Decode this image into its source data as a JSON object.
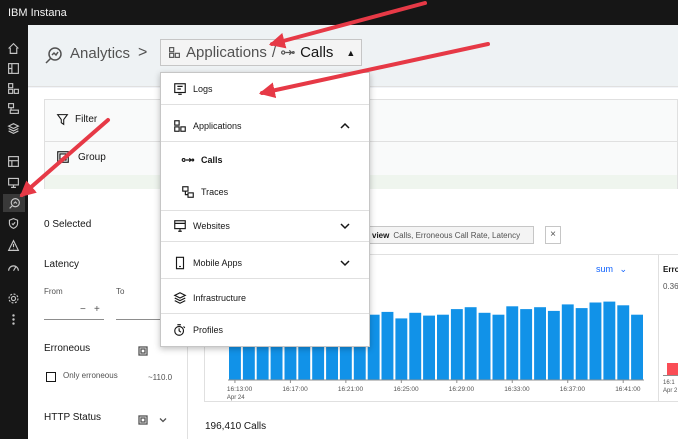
{
  "app": {
    "title": "IBM Instana"
  },
  "sidebar": {
    "items": [
      {
        "name": "home-icon"
      },
      {
        "name": "websites-icon"
      },
      {
        "name": "applications-icon"
      },
      {
        "name": "services-icon"
      },
      {
        "name": "infrastructure-icon"
      },
      {
        "name": "platforms-icon"
      },
      {
        "name": "monitor-icon"
      },
      {
        "name": "analytics-icon",
        "active": true
      },
      {
        "name": "security-icon"
      },
      {
        "name": "events-icon"
      },
      {
        "name": "dashboard-icon"
      },
      {
        "name": "settings-icon"
      },
      {
        "name": "more-icon"
      }
    ]
  },
  "breadcrumb": {
    "root": "Analytics",
    "separator": ">",
    "section": "Applications",
    "divider": "/",
    "current": "Calls"
  },
  "filter": {
    "filter_label": "Filter",
    "group_label": "Group"
  },
  "left_panel": {
    "selected": "0 Selected",
    "latency_label": "Latency",
    "from_label": "From",
    "to_label": "To",
    "minus": "−",
    "plus": "+",
    "erroneous_label": "Erroneous",
    "only_erroneous": "Only erroneous",
    "erroneous_value": "~110.0",
    "http_status_label": "HTTP Status"
  },
  "preview": {
    "label": "view",
    "text": "Calls, Erroneous Call Rate, Latency",
    "close": "×"
  },
  "chart_header": {
    "aggregation": "sum",
    "chevron": "⌄"
  },
  "erroneous_card": {
    "title": "Erro",
    "value": "0.36%",
    "tick": "16:1",
    "tick_date": "Apr 2"
  },
  "totals": {
    "calls": "196,410 Calls"
  },
  "dropdown": {
    "items": [
      {
        "label": "Logs"
      },
      {
        "label": "Applications",
        "expanded": true
      },
      {
        "label": "Calls",
        "selected": true
      },
      {
        "label": "Traces"
      },
      {
        "label": "Websites"
      },
      {
        "label": "Mobile Apps"
      },
      {
        "label": "Infrastructure"
      },
      {
        "label": "Profiles"
      }
    ]
  },
  "colors": {
    "bar": "#1192e8",
    "accent": "#0f62fe",
    "arrow": "#e63946",
    "error": "#fa4d56"
  },
  "chart_data": {
    "type": "bar",
    "x": [
      "16:13:00",
      "16:14:00",
      "16:15:00",
      "16:16:00",
      "16:17:00",
      "16:18:00",
      "16:19:00",
      "16:20:00",
      "16:21:00",
      "16:22:00",
      "16:23:00",
      "16:24:00",
      "16:25:00",
      "16:26:00",
      "16:27:00",
      "16:28:00",
      "16:29:00",
      "16:30:00",
      "16:31:00",
      "16:32:00",
      "16:33:00",
      "16:34:00",
      "16:35:00",
      "16:36:00",
      "16:37:00",
      "16:38:00",
      "16:39:00",
      "16:40:00",
      "16:41:00",
      "16:42:00"
    ],
    "values": [
      7300,
      7800,
      6900,
      7600,
      7200,
      7500,
      7100,
      6800,
      7700,
      7400,
      7000,
      7300,
      6600,
      7200,
      6900,
      7000,
      7600,
      7800,
      7200,
      7000,
      7900,
      7600,
      7800,
      7400,
      8100,
      7700,
      8300,
      8400,
      8000,
      7000
    ],
    "tick_labels": [
      "16:13:00",
      "16:17:00",
      "16:21:00",
      "16:25:00",
      "16:29:00",
      "16:33:00",
      "16:37:00",
      "16:41:00"
    ],
    "tick_sub": "Apr 24",
    "aggregation": "sum",
    "ylim": [
      0,
      9000
    ],
    "grid": false
  }
}
